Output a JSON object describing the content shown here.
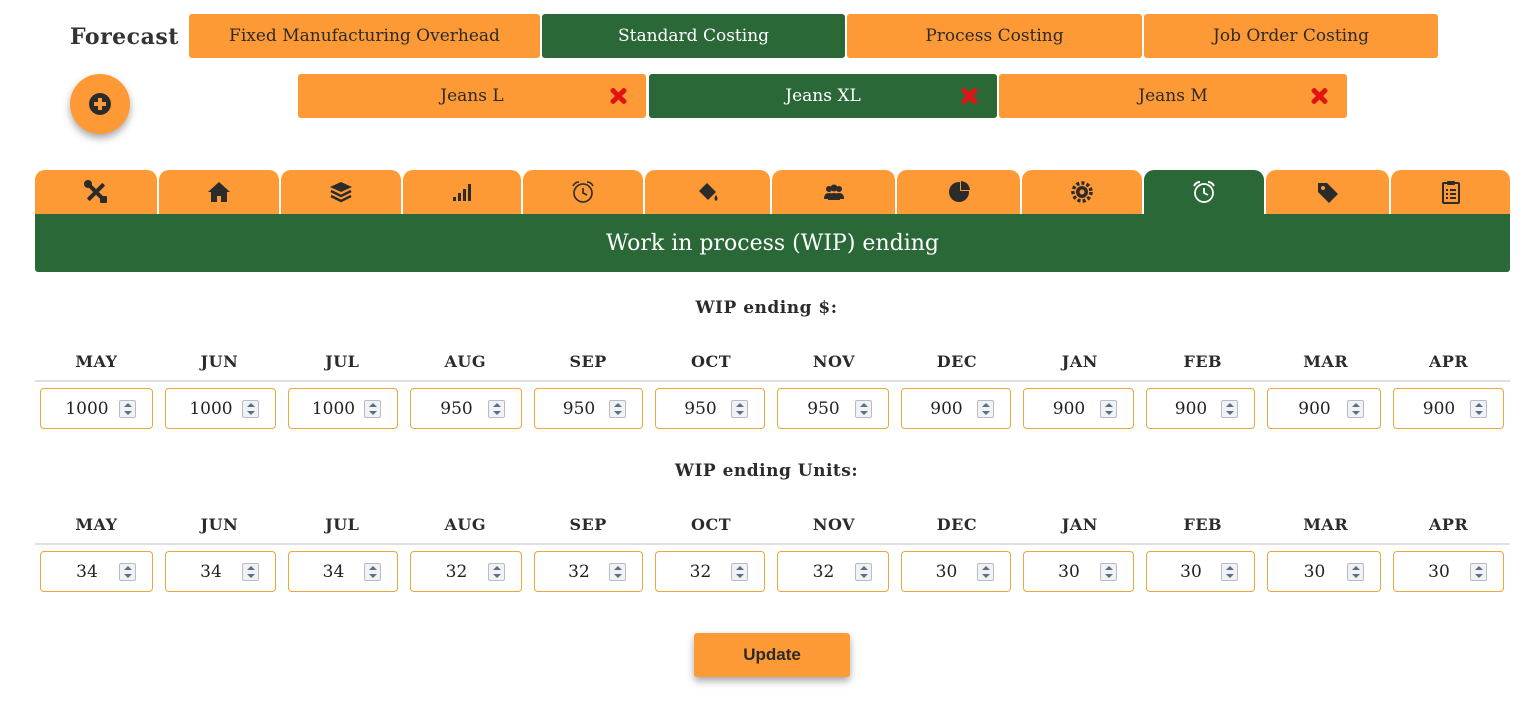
{
  "app": {
    "title": "Forecast"
  },
  "top_tabs": [
    {
      "label": "Fixed Manufacturing Overhead",
      "active": false
    },
    {
      "label": "Standard Costing",
      "active": true
    },
    {
      "label": "Process Costing",
      "active": false
    },
    {
      "label": "Job Order Costing",
      "active": false
    }
  ],
  "add_button": {
    "icon": "plus-circle-icon"
  },
  "products": [
    {
      "label": "Jeans L",
      "active": false,
      "close_icon": "close-x-icon"
    },
    {
      "label": "Jeans XL",
      "active": true,
      "close_icon": "close-x-icon"
    },
    {
      "label": "Jeans M",
      "active": false,
      "close_icon": "close-x-icon"
    }
  ],
  "nav_tabs": [
    {
      "icon": "tools-icon",
      "active": false
    },
    {
      "icon": "home-icon",
      "active": false
    },
    {
      "icon": "layers-icon",
      "active": false
    },
    {
      "icon": "signal-bars-icon",
      "active": false
    },
    {
      "icon": "alarm-clock-outline-icon",
      "active": false
    },
    {
      "icon": "paint-bucket-icon",
      "active": false
    },
    {
      "icon": "users-icon",
      "active": false
    },
    {
      "icon": "pie-chart-icon",
      "active": false
    },
    {
      "icon": "gear-icon",
      "active": false
    },
    {
      "icon": "alarm-clock-icon",
      "active": true
    },
    {
      "icon": "price-tag-icon",
      "active": false
    },
    {
      "icon": "clipboard-icon",
      "active": false
    }
  ],
  "section": {
    "title": "Work in process (WIP) ending"
  },
  "wip_dollars": {
    "title": "WIP ending $:",
    "months": [
      "MAY",
      "JUN",
      "JUL",
      "AUG",
      "SEP",
      "OCT",
      "NOV",
      "DEC",
      "JAN",
      "FEB",
      "MAR",
      "APR"
    ],
    "values": [
      "1000",
      "1000",
      "1000",
      "950",
      "950",
      "950",
      "950",
      "900",
      "900",
      "900",
      "900",
      "900"
    ]
  },
  "wip_units": {
    "title": "WIP ending Units:",
    "months": [
      "MAY",
      "JUN",
      "JUL",
      "AUG",
      "SEP",
      "OCT",
      "NOV",
      "DEC",
      "JAN",
      "FEB",
      "MAR",
      "APR"
    ],
    "values": [
      "34",
      "34",
      "34",
      "32",
      "32",
      "32",
      "32",
      "30",
      "30",
      "30",
      "30",
      "30"
    ]
  },
  "update_button": {
    "label": "Update"
  },
  "colors": {
    "accent": "#fd9a35",
    "active": "#2b6838",
    "close": "#e41313",
    "input_border": "#e8a83a"
  }
}
